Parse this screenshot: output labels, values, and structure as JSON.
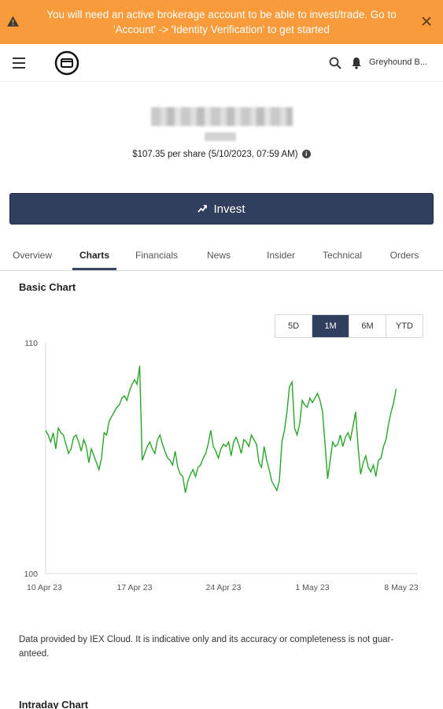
{
  "banner": {
    "message": "You will need an active brokerage account to be able to invest/trade. Go to 'Account' -> 'Identity Verification' to get started",
    "color": "#f79b3b"
  },
  "topbar": {
    "menu_icon": "hamburger-icon",
    "logo_icon": "app-logo-icon",
    "search_icon": "search-icon",
    "notification_icon": "bell-icon",
    "account_name": "Greyhound B..."
  },
  "quote": {
    "price_line": "$107.35 per share (5/10/2023, 07:59 AM)",
    "info_glyph": "i"
  },
  "invest_button": {
    "label": "Invest",
    "color": "#313f5e"
  },
  "tabs": [
    {
      "label": "Overview"
    },
    {
      "label": "Charts"
    },
    {
      "label": "Financials"
    },
    {
      "label": "News"
    },
    {
      "label": "Insider"
    },
    {
      "label": "Technical"
    },
    {
      "label": "Orders"
    }
  ],
  "active_tab": "Charts",
  "basic_chart": {
    "title": "Basic Chart",
    "ranges": [
      "5D",
      "1M",
      "6M",
      "YTD"
    ],
    "selected_range": "1M"
  },
  "chart_data": {
    "type": "line",
    "title": "",
    "xlabel": "",
    "ylabel": "",
    "ylim": [
      100,
      110
    ],
    "yticks": [
      "110",
      "100"
    ],
    "xticks": [
      "10 Apr 23",
      "17 Apr 23",
      "24 Apr 23",
      "1 May 23",
      "8 May 23"
    ],
    "xlim_days": [
      0,
      28
    ],
    "color": "#2aa52a",
    "x": [
      0.0,
      0.2,
      0.4,
      0.6,
      0.8,
      1.0,
      1.2,
      1.4,
      1.6,
      1.8,
      2.0,
      2.2,
      2.4,
      2.6,
      2.8,
      3.0,
      3.2,
      3.4,
      3.6,
      3.8,
      4.0,
      4.2,
      4.4,
      4.6,
      4.8,
      5.0,
      5.2,
      5.4,
      5.6,
      5.8,
      6.0,
      6.2,
      6.4,
      6.6,
      6.8,
      7.0,
      7.2,
      7.4,
      7.6,
      7.8,
      8.0,
      8.2,
      8.4,
      8.6,
      8.8,
      9.0,
      9.2,
      9.4,
      9.6,
      9.8,
      10.0,
      10.2,
      10.4,
      10.6,
      10.8,
      11.0,
      11.2,
      11.4,
      11.6,
      11.8,
      12.0,
      12.2,
      12.4,
      12.6,
      12.8,
      13.0,
      13.2,
      13.4,
      13.6,
      13.8,
      14.0,
      14.2,
      14.4,
      14.6,
      14.8,
      15.0,
      15.2,
      15.4,
      15.6,
      15.8,
      16.0,
      16.2,
      16.4,
      16.6,
      16.8,
      17.0,
      17.2,
      17.4,
      17.6,
      17.8,
      18.0,
      18.2,
      18.4,
      18.6,
      18.8,
      19.0,
      19.2,
      19.4,
      19.6,
      19.8,
      20.0,
      20.2,
      20.4,
      20.6,
      20.8,
      21.0,
      21.2,
      21.4,
      21.6,
      21.8,
      22.0,
      22.2,
      22.4,
      22.6,
      22.8,
      23.0,
      23.2,
      23.4,
      23.6,
      23.8,
      24.0,
      24.2,
      24.4,
      24.6,
      24.8,
      25.0,
      25.2,
      25.4,
      25.6,
      25.8,
      26.0,
      26.2,
      26.4,
      26.6,
      26.8,
      27.0,
      27.2,
      27.4,
      27.6
    ],
    "values": [
      106.2,
      106.0,
      105.7,
      106.1,
      105.4,
      106.3,
      106.1,
      106.0,
      105.6,
      105.2,
      105.4,
      105.9,
      106.0,
      105.7,
      105.3,
      105.8,
      105.5,
      104.8,
      105.4,
      105.1,
      104.8,
      104.5,
      105.0,
      106.1,
      106.0,
      106.6,
      106.8,
      107.0,
      107.2,
      107.3,
      107.6,
      107.7,
      107.5,
      107.9,
      108.2,
      108.4,
      108.2,
      109.0,
      104.9,
      105.2,
      105.5,
      105.7,
      105.4,
      105.2,
      105.8,
      106.0,
      105.6,
      105.3,
      105.0,
      104.9,
      104.7,
      105.3,
      104.6,
      104.3,
      104.2,
      103.5,
      104.0,
      104.3,
      104.5,
      104.2,
      104.6,
      104.7,
      105.0,
      105.2,
      105.6,
      106.2,
      105.5,
      105.3,
      105.0,
      105.4,
      105.6,
      105.5,
      105.7,
      105.1,
      105.7,
      105.9,
      105.6,
      105.2,
      105.8,
      105.7,
      105.5,
      106.0,
      105.8,
      105.6,
      104.8,
      104.6,
      105.5,
      104.9,
      104.5,
      104.0,
      103.8,
      103.6,
      104.0,
      105.7,
      106.2,
      107.0,
      108.1,
      108.3,
      106.3,
      106.0,
      106.5,
      107.5,
      107.3,
      107.2,
      107.6,
      107.4,
      107.6,
      107.8,
      107.5,
      107.0,
      105.6,
      104.1,
      104.9,
      105.7,
      105.5,
      105.6,
      106.0,
      105.5,
      105.9,
      106.1,
      105.8,
      106.4,
      107.0,
      105.5,
      104.3,
      104.8,
      105.1,
      104.6,
      104.4,
      104.7,
      104.2,
      104.9,
      105.0,
      105.5,
      105.8,
      106.5,
      107.0,
      107.4,
      108.0,
      107.7
    ]
  },
  "disclaimer": "Data provided by IEX Cloud. It is indicative only and its accuracy or completeness is not guar-anteed.",
  "intraday_chart": {
    "title": "Intraday Chart"
  }
}
